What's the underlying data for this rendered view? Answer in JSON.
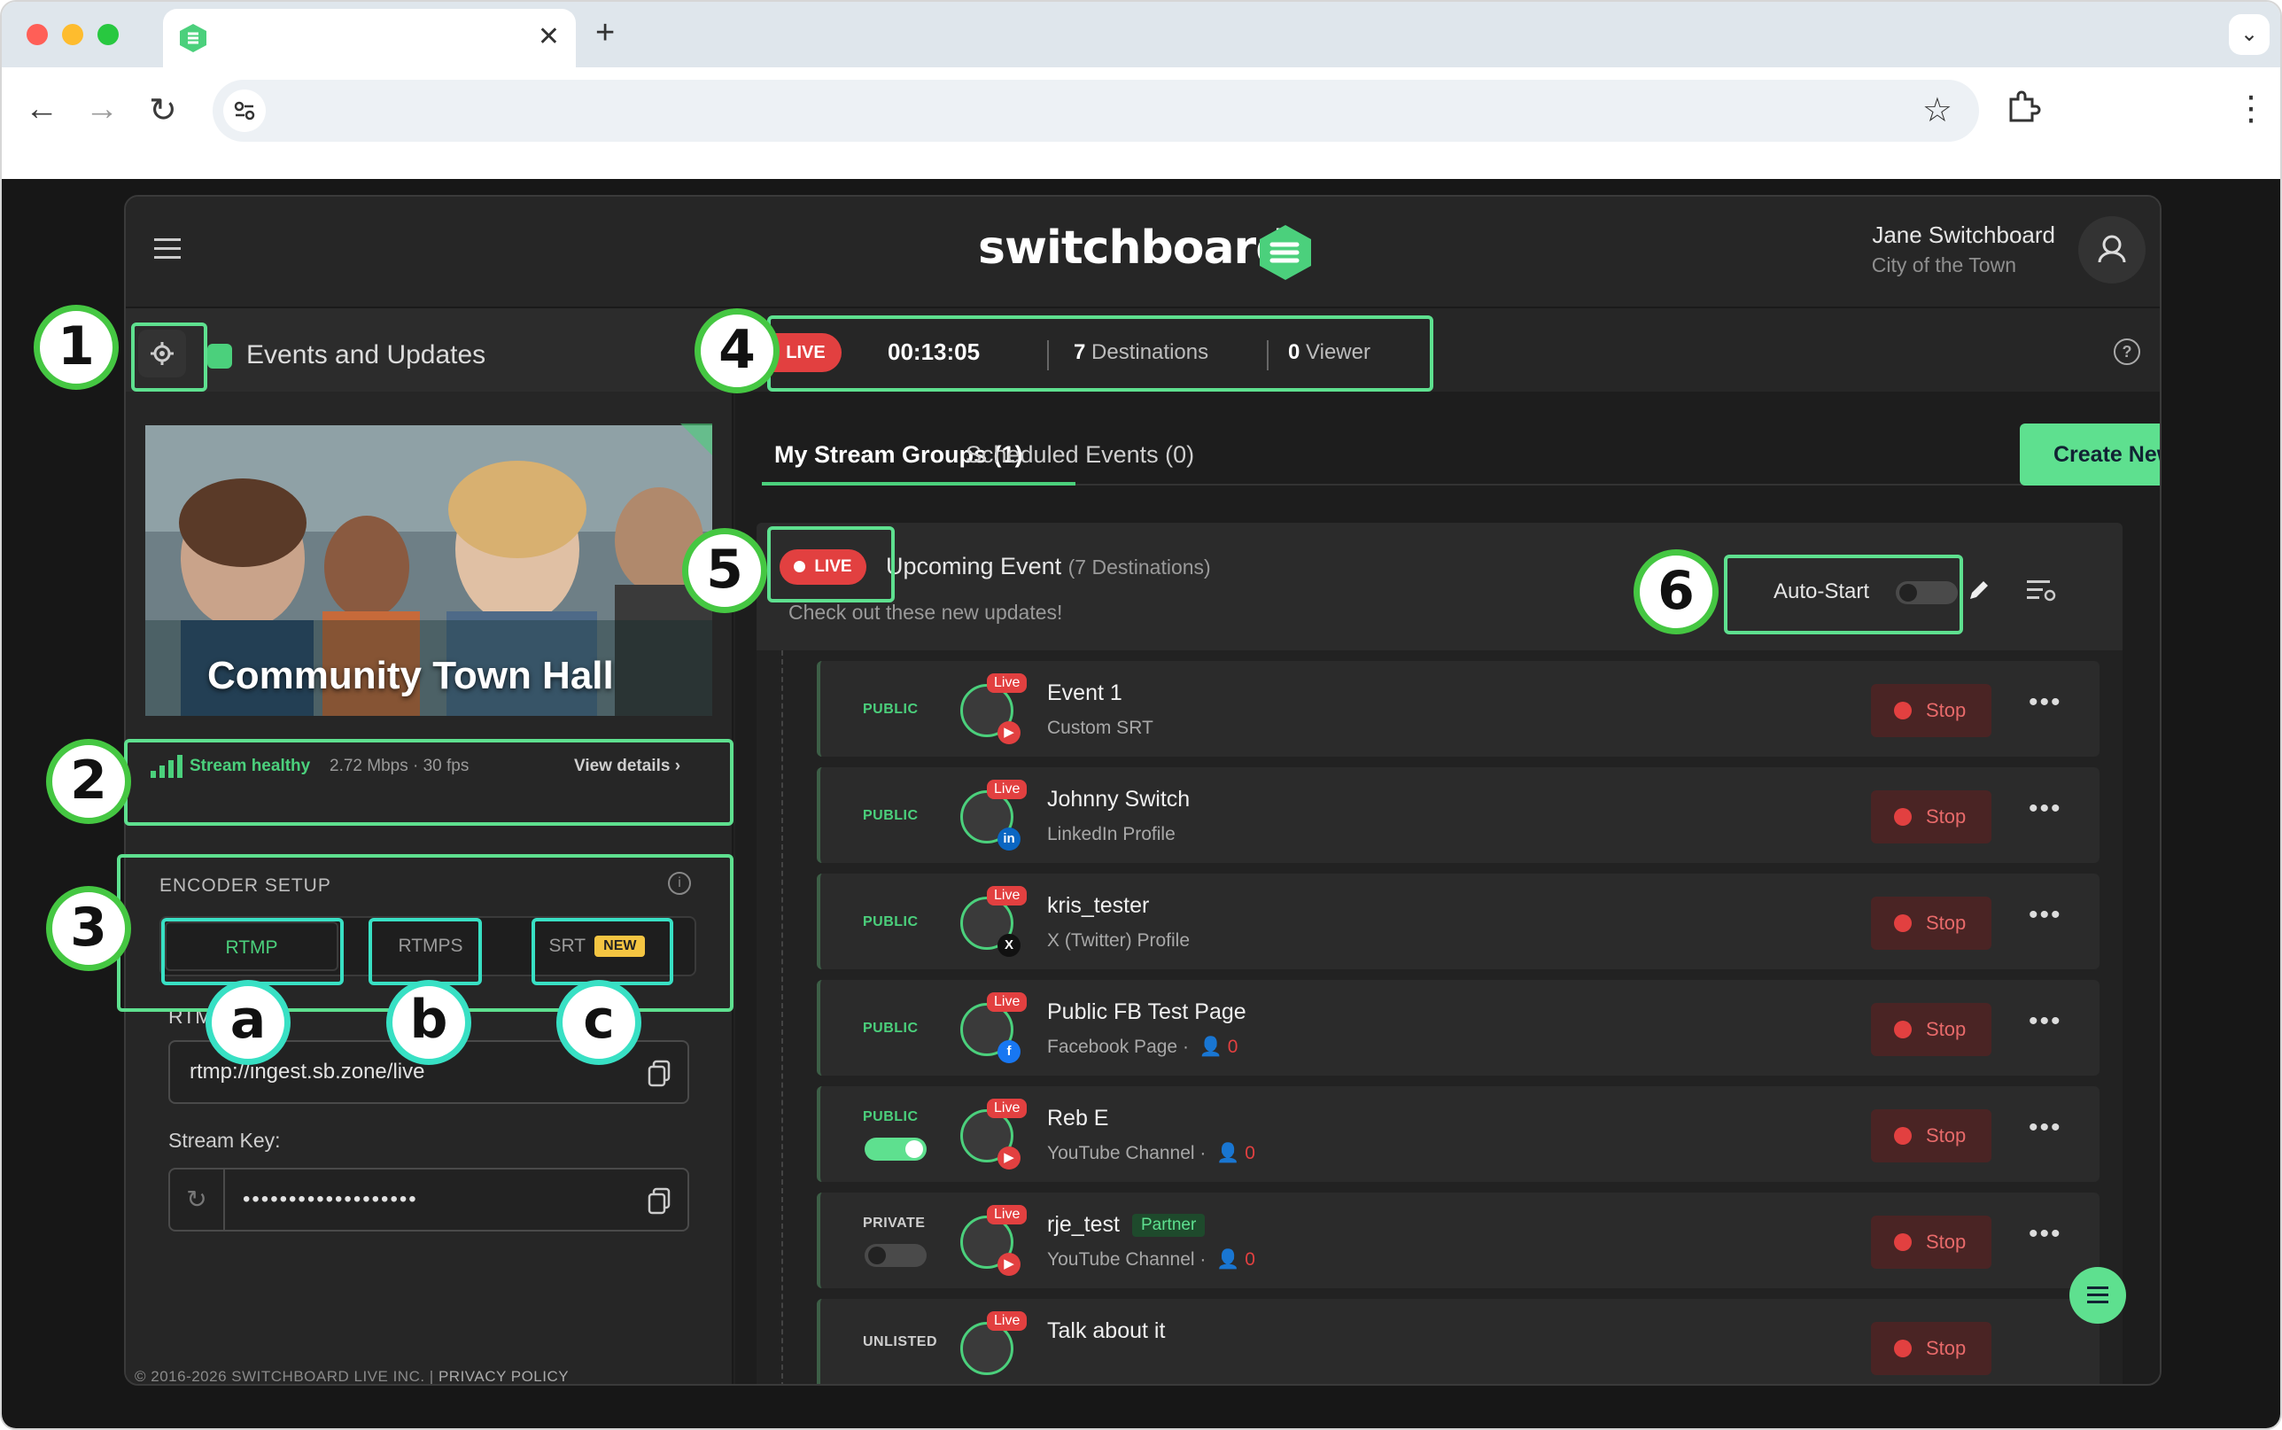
{
  "browser": {
    "tab_close": "✕",
    "new_tab": "+",
    "tab_menu": "⌄",
    "url": "",
    "traffic_colors": [
      "#ff5f57",
      "#febc2e",
      "#28c840"
    ]
  },
  "app": {
    "brand": "switchboard",
    "user_name": "Jane Switchboard",
    "user_org": "City of the Town",
    "accent_color": "#5ee08f",
    "live_color": "#e24040"
  },
  "left": {
    "event_title": "Events and Updates",
    "thumbnail_title": "Community Town Hall",
    "health_label": "Stream healthy",
    "health_metrics": "2.72 Mbps · 30 fps",
    "view_details": "View details ›",
    "encoder_title": "ENCODER SETUP",
    "protocols": [
      {
        "label": "RTMP",
        "active": true
      },
      {
        "label": "RTMPS",
        "active": false
      },
      {
        "label": "SRT",
        "active": false,
        "badge": "NEW"
      }
    ],
    "rtmp_url_label": "RTMP URL:",
    "rtmp_url": "rtmp://ingest.sb.zone/live",
    "stream_key_label": "Stream Key:",
    "stream_key": "•••••••••••••••••••",
    "footer_copy": "© 2016-2026 SWITCHBOARD LIVE INC. |",
    "footer_privacy": "PRIVACY POLICY"
  },
  "status": {
    "live_label": "LIVE",
    "timer": "00:13:05",
    "destinations_count": "7",
    "destinations_label": "Destinations",
    "viewer_count": "0",
    "viewer_label": "Viewer"
  },
  "tabs": {
    "mine": "My Stream Groups (1)",
    "scheduled": "Scheduled Events (0)",
    "create_new": "Create New"
  },
  "group": {
    "live_label": "LIVE",
    "title": "Upcoming Event",
    "destinations_note": "(7 Destinations)",
    "subtitle": "Check out these new updates!",
    "auto_start_label": "Auto-Start",
    "auto_start_on": false
  },
  "destinations": [
    {
      "visibility": "PUBLIC",
      "name": "Event 1",
      "platform": "Custom SRT",
      "viewers": "",
      "badge": "",
      "live": "Live",
      "platform_icon": "youtube-icon",
      "badge_color": "#e24040",
      "badge_glyph": "▶"
    },
    {
      "visibility": "PUBLIC",
      "name": "Johnny Switch",
      "platform": "LinkedIn Profile",
      "viewers": "",
      "badge": "",
      "live": "Live",
      "platform_icon": "linkedin-icon",
      "badge_color": "#0a66c2",
      "badge_glyph": "in"
    },
    {
      "visibility": "PUBLIC",
      "name": "kris_tester",
      "platform": "X (Twitter) Profile",
      "viewers": "",
      "badge": "",
      "live": "Live",
      "platform_icon": "x-icon",
      "badge_color": "#111111",
      "badge_glyph": "X"
    },
    {
      "visibility": "PUBLIC",
      "name": "Public FB Test Page",
      "platform": "Facebook Page",
      "viewers": "0",
      "badge": "",
      "live": "Live",
      "platform_icon": "facebook-icon",
      "badge_color": "#1877f2",
      "badge_glyph": "f"
    },
    {
      "visibility": "PUBLIC",
      "name": "Reb E",
      "platform": "YouTube Channel",
      "viewers": "0",
      "badge": "",
      "live": "Live",
      "platform_icon": "youtube-icon",
      "badge_color": "#e24040",
      "badge_glyph": "▶",
      "toggle": true,
      "toggle_on": true
    },
    {
      "visibility": "PRIVATE",
      "name": "rje_test",
      "platform": "YouTube Channel",
      "viewers": "0",
      "badge": "Partner",
      "live": "Live",
      "platform_icon": "youtube-icon",
      "badge_color": "#e24040",
      "badge_glyph": "▶",
      "toggle": true,
      "toggle_on": false
    },
    {
      "visibility": "UNLISTED",
      "name": "Talk about it",
      "platform": "",
      "viewers": "",
      "badge": "",
      "live": "Live",
      "platform_icon": "youtube-icon",
      "badge_color": "#e24040",
      "badge_glyph": "▶"
    }
  ],
  "dest_action": {
    "stop_label": "Stop",
    "more_label": "•••"
  },
  "callouts": {
    "numbers": [
      "1",
      "2",
      "3",
      "4",
      "5",
      "6"
    ],
    "letters": [
      "a",
      "b",
      "c"
    ]
  }
}
